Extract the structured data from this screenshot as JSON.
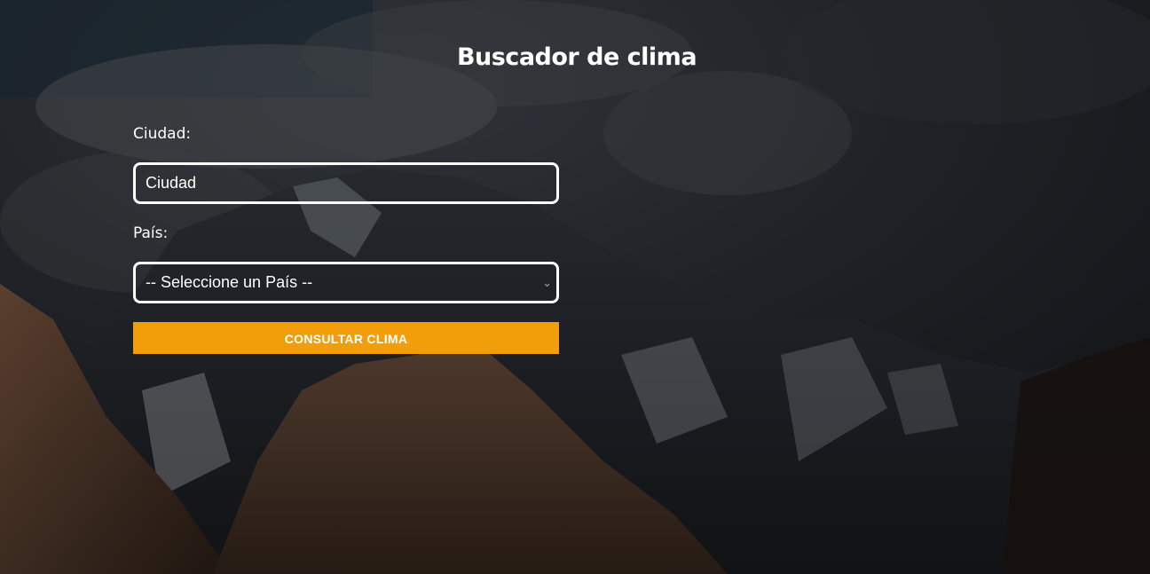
{
  "page": {
    "title": "Buscador de clima"
  },
  "form": {
    "city_label": "Ciudad:",
    "city_value": "Ciudad",
    "country_label": "País:",
    "country_selected": "-- Seleccione un País --",
    "submit_label": "Consultar Clima"
  },
  "icons": {
    "select_arrow": "chevron-down-icon"
  },
  "colors": {
    "accent": "#f29d0a",
    "field_border": "#ffffff",
    "background_dark": "#1b2026"
  }
}
